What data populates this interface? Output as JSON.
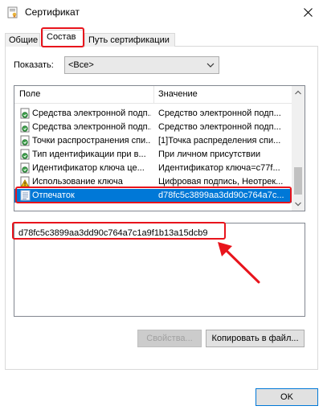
{
  "window": {
    "title": "Сертификат"
  },
  "tabs": [
    {
      "label": "Общие"
    },
    {
      "label": "Состав"
    },
    {
      "label": "Путь сертификации"
    }
  ],
  "show": {
    "label": "Показать:",
    "value": "<Все>"
  },
  "list": {
    "columns": {
      "field": "Поле",
      "value": "Значение"
    },
    "rows": [
      {
        "field": "Средства электронной подп...",
        "value": "Средство электронной подп...",
        "icon": "certificate-field-icon"
      },
      {
        "field": "Средства электронной подп...",
        "value": "Средство электронной подп...",
        "icon": "certificate-field-icon"
      },
      {
        "field": "Точки распространения спи...",
        "value": "[1]Точка распределения спи...",
        "icon": "certificate-field-icon"
      },
      {
        "field": "Тип идентификации при в...",
        "value": "При личном присутствии",
        "icon": "certificate-field-icon"
      },
      {
        "field": "Идентификатор ключа це...",
        "value": "Идентификатор ключа=c77f...",
        "icon": "certificate-field-icon"
      },
      {
        "field": "Использование ключа",
        "value": "Цифровая подпись, Неотрек...",
        "icon": "key-usage-warning-icon"
      },
      {
        "field": "Отпечаток",
        "value": "d78fc5c3899aa3dd90c764a7c...",
        "icon": "document-field-icon",
        "selected": true
      }
    ]
  },
  "detail": {
    "value": "d78fc5c3899aa3dd90c764a7c1a9f1b13a15dcb9"
  },
  "buttons": {
    "properties": "Свойства...",
    "copy_to_file": "Копировать в файл...",
    "ok": "OK"
  },
  "colors": {
    "selection": "#0078d7",
    "highlight": "#e8141c"
  }
}
